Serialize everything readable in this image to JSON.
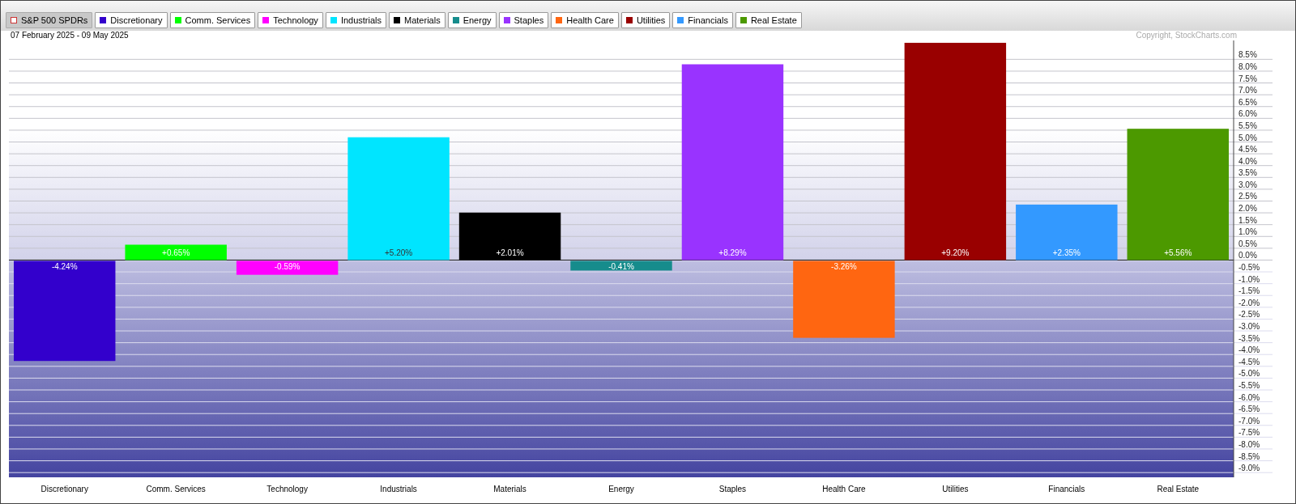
{
  "toolbar": {
    "items": [
      {
        "label": "S&P 500 SPDRs",
        "kind": "group",
        "color": "#cc3333",
        "selected": true
      },
      {
        "label": "Discretionary",
        "kind": "sector",
        "color": "#3300cc",
        "selected": false
      },
      {
        "label": "Comm. Services",
        "kind": "sector",
        "color": "#00ff00",
        "selected": false
      },
      {
        "label": "Technology",
        "kind": "sector",
        "color": "#ff00ff",
        "selected": false
      },
      {
        "label": "Industrials",
        "kind": "sector",
        "color": "#00e5ff",
        "selected": false
      },
      {
        "label": "Materials",
        "kind": "sector",
        "color": "#000000",
        "selected": false
      },
      {
        "label": "Energy",
        "kind": "sector",
        "color": "#168c8c",
        "selected": false
      },
      {
        "label": "Staples",
        "kind": "sector",
        "color": "#9933ff",
        "selected": false
      },
      {
        "label": "Health Care",
        "kind": "sector",
        "color": "#ff6611",
        "selected": false
      },
      {
        "label": "Utilities",
        "kind": "sector",
        "color": "#990000",
        "selected": false
      },
      {
        "label": "Financials",
        "kind": "sector",
        "color": "#3399ff",
        "selected": false
      },
      {
        "label": "Real Estate",
        "kind": "sector",
        "color": "#4c9900",
        "selected": false
      }
    ]
  },
  "date_range": "07 February 2025 - 09 May 2025",
  "copyright": "Copyright, StockCharts.com",
  "chart_data": {
    "type": "bar",
    "categories": [
      "Discretionary",
      "Comm. Services",
      "Technology",
      "Industrials",
      "Materials",
      "Energy",
      "Staples",
      "Health Care",
      "Utilities",
      "Financials",
      "Real Estate"
    ],
    "grid": true,
    "series": [
      {
        "values": [
          -4.24,
          0.65,
          -0.59,
          5.2,
          2.01,
          -0.41,
          8.29,
          -3.26,
          9.2,
          2.35,
          5.56
        ]
      }
    ],
    "value_labels": [
      "-4.24%",
      "+0.65%",
      "-0.59%",
      "+5.20%",
      "+2.01%",
      "-0.41%",
      "+8.29%",
      "-3.26%",
      "+9.20%",
      "+2.35%",
      "+5.56%"
    ],
    "ylim": [
      -9.2,
      9.3
    ],
    "yticks": [
      {
        "value": 8.5,
        "label": "8.5%"
      },
      {
        "value": 8,
        "label": "8.0%"
      },
      {
        "value": 7.5,
        "label": "7.5%"
      },
      {
        "value": 7,
        "label": "7.0%"
      },
      {
        "value": 6.5,
        "label": "6.5%"
      },
      {
        "value": 6,
        "label": "6.0%"
      },
      {
        "value": 5.5,
        "label": "5.5%"
      },
      {
        "value": 5,
        "label": "5.0%"
      },
      {
        "value": 4.5,
        "label": "4.5%"
      },
      {
        "value": 4,
        "label": "4.0%"
      },
      {
        "value": 3.5,
        "label": "3.5%"
      },
      {
        "value": 3,
        "label": "3.0%"
      },
      {
        "value": 2.5,
        "label": "2.5%"
      },
      {
        "value": 2,
        "label": "2.0%"
      },
      {
        "value": 1.5,
        "label": "1.5%"
      },
      {
        "value": 1,
        "label": "1.0%"
      },
      {
        "value": 0.5,
        "label": "0.5%"
      },
      {
        "value": 0,
        "label": "0.0%"
      },
      {
        "value": -0.5,
        "label": "-0.5%"
      },
      {
        "value": -1,
        "label": "-1.0%"
      },
      {
        "value": -1.5,
        "label": "-1.5%"
      },
      {
        "value": -2,
        "label": "-2.0%"
      },
      {
        "value": -2.5,
        "label": "-2.5%"
      },
      {
        "value": -3,
        "label": "-3.0%"
      },
      {
        "value": -3.5,
        "label": "-3.5%"
      },
      {
        "value": -4,
        "label": "-4.0%"
      },
      {
        "value": -4.5,
        "label": "-4.5%"
      },
      {
        "value": -5,
        "label": "-5.0%"
      },
      {
        "value": -5.5,
        "label": "-5.5%"
      },
      {
        "value": -6,
        "label": "-6.0%"
      },
      {
        "value": -6.5,
        "label": "-6.5%"
      },
      {
        "value": -7,
        "label": "-7.0%"
      },
      {
        "value": -7.5,
        "label": "-7.5%"
      },
      {
        "value": -8,
        "label": "-8.0%"
      },
      {
        "value": -8.5,
        "label": "-8.5%"
      },
      {
        "value": -9,
        "label": "-9.0%"
      }
    ]
  }
}
